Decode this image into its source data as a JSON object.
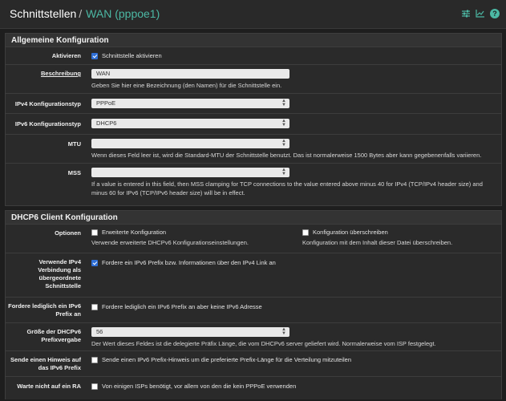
{
  "header": {
    "crumb_parent": "Schnittstellen",
    "crumb_separator": "/",
    "crumb_current": "WAN (pppoe1)",
    "tools": [
      "sliders-icon",
      "chart-icon",
      "help-icon"
    ]
  },
  "general": {
    "title": "Allgemeine Konfiguration",
    "enable": {
      "label": "Aktivieren",
      "text": "Schnittstelle aktivieren",
      "checked": true
    },
    "description": {
      "label": "Beschreibung",
      "value": "WAN",
      "help": "Geben Sie hier eine Bezeichnung (den Namen) für die Schnittstelle ein."
    },
    "ipv4type": {
      "label": "IPv4 Konfigurationstyp",
      "value": "PPPoE"
    },
    "ipv6type": {
      "label": "IPv6 Konfigurationstyp",
      "value": "DHCP6"
    },
    "mtu": {
      "label": "MTU",
      "value": "",
      "help": "Wenn dieses Feld leer ist, wird die Standard-MTU der Schnittstelle benutzt. Das ist normalerweise 1500 Bytes aber kann gegebenenfalls variieren."
    },
    "mss": {
      "label": "MSS",
      "value": "",
      "help1": "If a value is entered in this field, then MSS clamping for TCP connections to the value entered above minus 40 for IPv4 (TCP/IPv4 header size) and",
      "help2": "minus 60 for IPv6 (TCP/IPv6 header size) will be in effect."
    }
  },
  "dhcp6": {
    "title": "DHCP6 Client Konfiguration",
    "options": {
      "label": "Optionen",
      "advanced_text": "Erweiterte Konfiguration",
      "advanced_help": "Verwende erweiterte DHCPv6 Konfigurationseinstellungen.",
      "override_text": "Konfiguration überschreiben",
      "override_help": "Konfiguration mit dem Inhalt dieser Datei überschreiben."
    },
    "use_ipv4": {
      "label1": "Verwende IPv4",
      "label2": "Verbindung als",
      "label3": "übergeordnete",
      "label4": "Schnittstelle",
      "text": "Fordere ein IPv6 Prefix bzw. Informationen über den IPv4 Link an",
      "checked": true
    },
    "prefix_only": {
      "label1": "Fordere lediglich ein IPv6",
      "label2": "Prefix an",
      "text": "Fordere lediglich ein IPv6 Prefix an aber keine IPv6 Adresse",
      "checked": false
    },
    "prefix_size": {
      "label1": "Größe der DHCPv6",
      "label2": "Prefixvergabe",
      "value": "56",
      "help": "Der Wert dieses Feldes ist die delegierte Präfix Länge, die vom DHCPv6 server geliefert wird. Normalerweise vom ISP festgelegt."
    },
    "hint": {
      "label1": "Sende einen Hinweis auf",
      "label2": "das IPv6 Prefix",
      "text": "Sende einen IPv6 Prefix-Hinweis um die preferierte Prefix-Länge für die Verteilung mitzuteilen",
      "checked": false
    },
    "no_ra": {
      "label": "Warte nicht auf ein RA",
      "text": "Von einigen ISPs benötigt, vor allem von den die kein PPPoE verwenden",
      "checked": false
    }
  }
}
